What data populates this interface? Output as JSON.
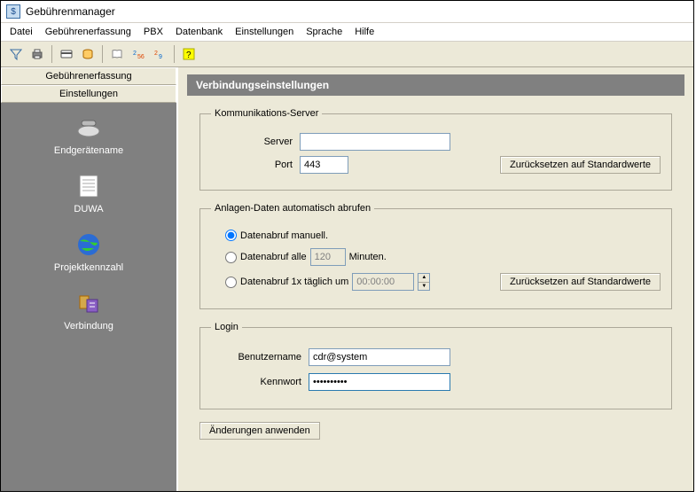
{
  "window": {
    "title": "Gebührenmanager"
  },
  "menu": {
    "file": "Datei",
    "charges": "Gebührenerfassung",
    "pbx": "PBX",
    "database": "Datenbank",
    "settings": "Einstellungen",
    "language": "Sprache",
    "help": "Hilfe"
  },
  "sidebar": {
    "tab_charges": "Gebührenerfassung",
    "tab_settings": "Einstellungen",
    "items": [
      {
        "label": "Endgerätename"
      },
      {
        "label": "DUWA"
      },
      {
        "label": "Projektkennzahl"
      },
      {
        "label": "Verbindung"
      }
    ]
  },
  "panel": {
    "title": "Verbindungseinstellungen"
  },
  "comm": {
    "legend": "Kommunikations-Server",
    "server_label": "Server",
    "server_value": "",
    "port_label": "Port",
    "port_value": "443",
    "reset_button": "Zurücksetzen auf Standardwerte"
  },
  "retrieval": {
    "legend": "Anlagen-Daten automatisch abrufen",
    "opt_manual": "Datenabruf manuell.",
    "opt_interval_prefix": "Datenabruf alle",
    "opt_interval_value": "120",
    "opt_interval_suffix": "Minuten.",
    "opt_daily_prefix": "Datenabruf 1x täglich um",
    "opt_daily_value": "00:00:00",
    "reset_button": "Zurücksetzen auf Standardwerte"
  },
  "login": {
    "legend": "Login",
    "user_label": "Benutzername",
    "user_value": "cdr@system",
    "pass_label": "Kennwort",
    "pass_value": "••••••••••"
  },
  "apply_button": "Änderungen anwenden"
}
